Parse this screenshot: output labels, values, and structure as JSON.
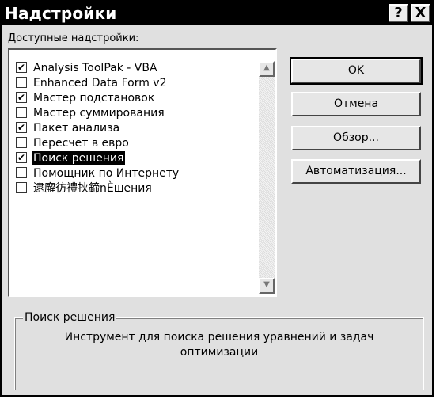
{
  "window": {
    "title": "Надстройки",
    "help_glyph": "?",
    "close_glyph": "X"
  },
  "list": {
    "label": "Доступные надстройки:",
    "items": [
      {
        "label": "Analysis ToolPak - VBA",
        "checked": true,
        "check": "✔"
      },
      {
        "label": "Enhanced Data Form v2",
        "checked": false,
        "check": ""
      },
      {
        "label": "Мастер подстановок",
        "checked": true,
        "check": "✔"
      },
      {
        "label": "Мастер суммирования",
        "checked": false,
        "check": ""
      },
      {
        "label": "Пакет анализа",
        "checked": true,
        "check": "✔"
      },
      {
        "label": "Пересчет в евро",
        "checked": false,
        "check": ""
      },
      {
        "label": "Поиск решения",
        "checked": true,
        "check": "✔",
        "selected": true
      },
      {
        "label": "Помощник по Интернету",
        "checked": false,
        "check": ""
      },
      {
        "label": "逮廨彷禮挟鍗nÈшения",
        "checked": false,
        "check": ""
      }
    ]
  },
  "buttons": {
    "ok": "OK",
    "cancel": "Отмена",
    "browse": "Обзор...",
    "automation": "Автоматизация..."
  },
  "description": {
    "title": "Поиск решения",
    "text": "Инструмент для поиска решения уравнений и задач оптимизации"
  },
  "colors": {
    "titlebar": "#000000",
    "dialog_bg": "#e0e0e0",
    "selection": "#000000"
  }
}
